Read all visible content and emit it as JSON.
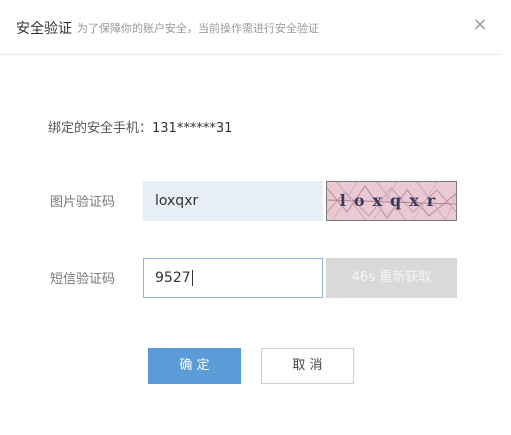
{
  "header": {
    "title": "安全验证",
    "subtitle": "为了保障你的账户安全，当前操作需进行安全验证",
    "close_icon": "close-icon",
    "close_glyph": "×"
  },
  "phone": {
    "label": "绑定的安全手机：",
    "number": "131******31"
  },
  "captcha": {
    "label": "图片验证码",
    "value": "loxqxr",
    "image_text": "loxqxr"
  },
  "sms": {
    "label": "短信验证码",
    "value": "9527",
    "resend_label": "46s 重新获取"
  },
  "buttons": {
    "confirm": "确 定",
    "cancel": "取 消"
  },
  "colors": {
    "primary": "#5b9bd8",
    "disabled": "#d9d9d9",
    "captcha_bg": "#e9c9d3"
  }
}
